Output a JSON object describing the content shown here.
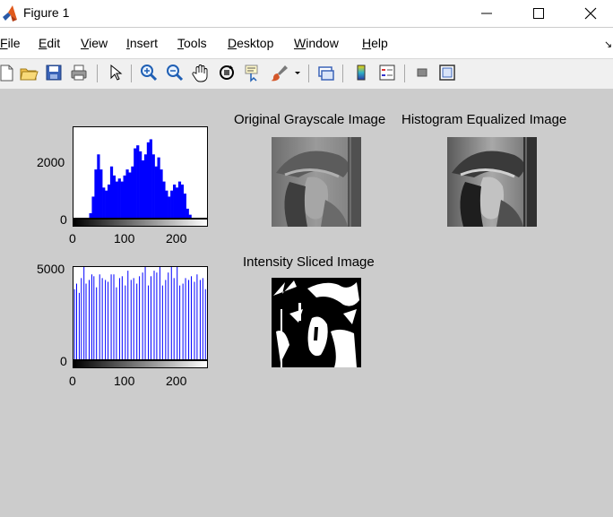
{
  "window": {
    "title": "Figure 1"
  },
  "menu": {
    "items": [
      {
        "first": "F",
        "rest": "ile"
      },
      {
        "first": "E",
        "rest": "dit"
      },
      {
        "first": "V",
        "rest": "iew"
      },
      {
        "first": "I",
        "rest": "nsert"
      },
      {
        "first": "T",
        "rest": "ools"
      },
      {
        "first": "D",
        "rest": "esktop"
      },
      {
        "first": "W",
        "rest": "indow"
      },
      {
        "first": "H",
        "rest": "elp"
      }
    ],
    "overflow_arrow": "↘"
  },
  "toolbar": {
    "icons": [
      "new-figure-icon",
      "open-file-icon",
      "save-figure-icon",
      "print-figure-icon",
      "edit-plot-icon",
      "zoom-in-icon",
      "zoom-out-icon",
      "pan-icon",
      "rotate-3d-icon",
      "data-cursor-icon",
      "brush-icon",
      "brush-dropdown-icon",
      "link-plot-icon",
      "insert-colorbar-icon",
      "insert-legend-icon",
      "hide-plot-tools-icon",
      "show-plot-tools-icon"
    ]
  },
  "colors": {
    "figure_bg": "#cccccc",
    "hist_color": "#0000ff"
  },
  "panels": {
    "original_title": "Original Grayscale Image",
    "equalized_title": "Histogram Equalized Image",
    "sliced_title": "Intensity Sliced Image"
  },
  "chart_data": [
    {
      "type": "bar",
      "title": "",
      "xlabel": "",
      "ylabel": "",
      "xlim": [
        0,
        255
      ],
      "ylim": [
        0,
        3000
      ],
      "xticks": [
        "0",
        "100",
        "200"
      ],
      "yticks": [
        "0",
        "2000"
      ],
      "x": [
        25,
        30,
        35,
        40,
        45,
        50,
        55,
        60,
        65,
        70,
        75,
        80,
        85,
        90,
        95,
        100,
        105,
        110,
        115,
        120,
        125,
        130,
        135,
        140,
        145,
        150,
        155,
        160,
        165,
        170,
        175,
        180,
        185,
        190,
        195,
        200,
        205,
        210,
        215,
        220,
        225
      ],
      "values": [
        0,
        150,
        700,
        1600,
        2100,
        1600,
        1000,
        900,
        1100,
        1700,
        1400,
        1200,
        1300,
        1200,
        1400,
        1600,
        1500,
        1700,
        2300,
        2400,
        2200,
        1900,
        2100,
        2500,
        2600,
        2100,
        1700,
        2000,
        1600,
        1200,
        900,
        700,
        900,
        1100,
        1000,
        1200,
        1100,
        800,
        300,
        100,
        0
      ]
    },
    {
      "type": "bar",
      "title": "",
      "xlabel": "",
      "ylabel": "",
      "xlim": [
        0,
        255
      ],
      "ylim": [
        0,
        5000
      ],
      "xticks": [
        "0",
        "100",
        "200"
      ],
      "yticks": [
        "0",
        "5000"
      ],
      "x": [
        2,
        6,
        11,
        15,
        20,
        24,
        30,
        35,
        39,
        44,
        50,
        55,
        61,
        66,
        72,
        77,
        82,
        88,
        93,
        99,
        104,
        110,
        115,
        121,
        126,
        132,
        137,
        143,
        148,
        154,
        159,
        165,
        170,
        176,
        181,
        187,
        192,
        198,
        203,
        209,
        214,
        220,
        225,
        231,
        236,
        242,
        247,
        252
      ],
      "values": [
        3800,
        4100,
        3600,
        4400,
        5000,
        4100,
        4300,
        4600,
        4500,
        3900,
        4600,
        4400,
        4300,
        4200,
        4600,
        4600,
        3900,
        4400,
        4500,
        4000,
        4800,
        4300,
        4400,
        4100,
        4500,
        4700,
        5000,
        4000,
        4500,
        4800,
        4700,
        5000,
        4000,
        4300,
        4700,
        5000,
        4400,
        5000,
        4000,
        4100,
        4400,
        4300,
        4500,
        4200,
        4600,
        4300,
        4400,
        3800
      ]
    }
  ]
}
